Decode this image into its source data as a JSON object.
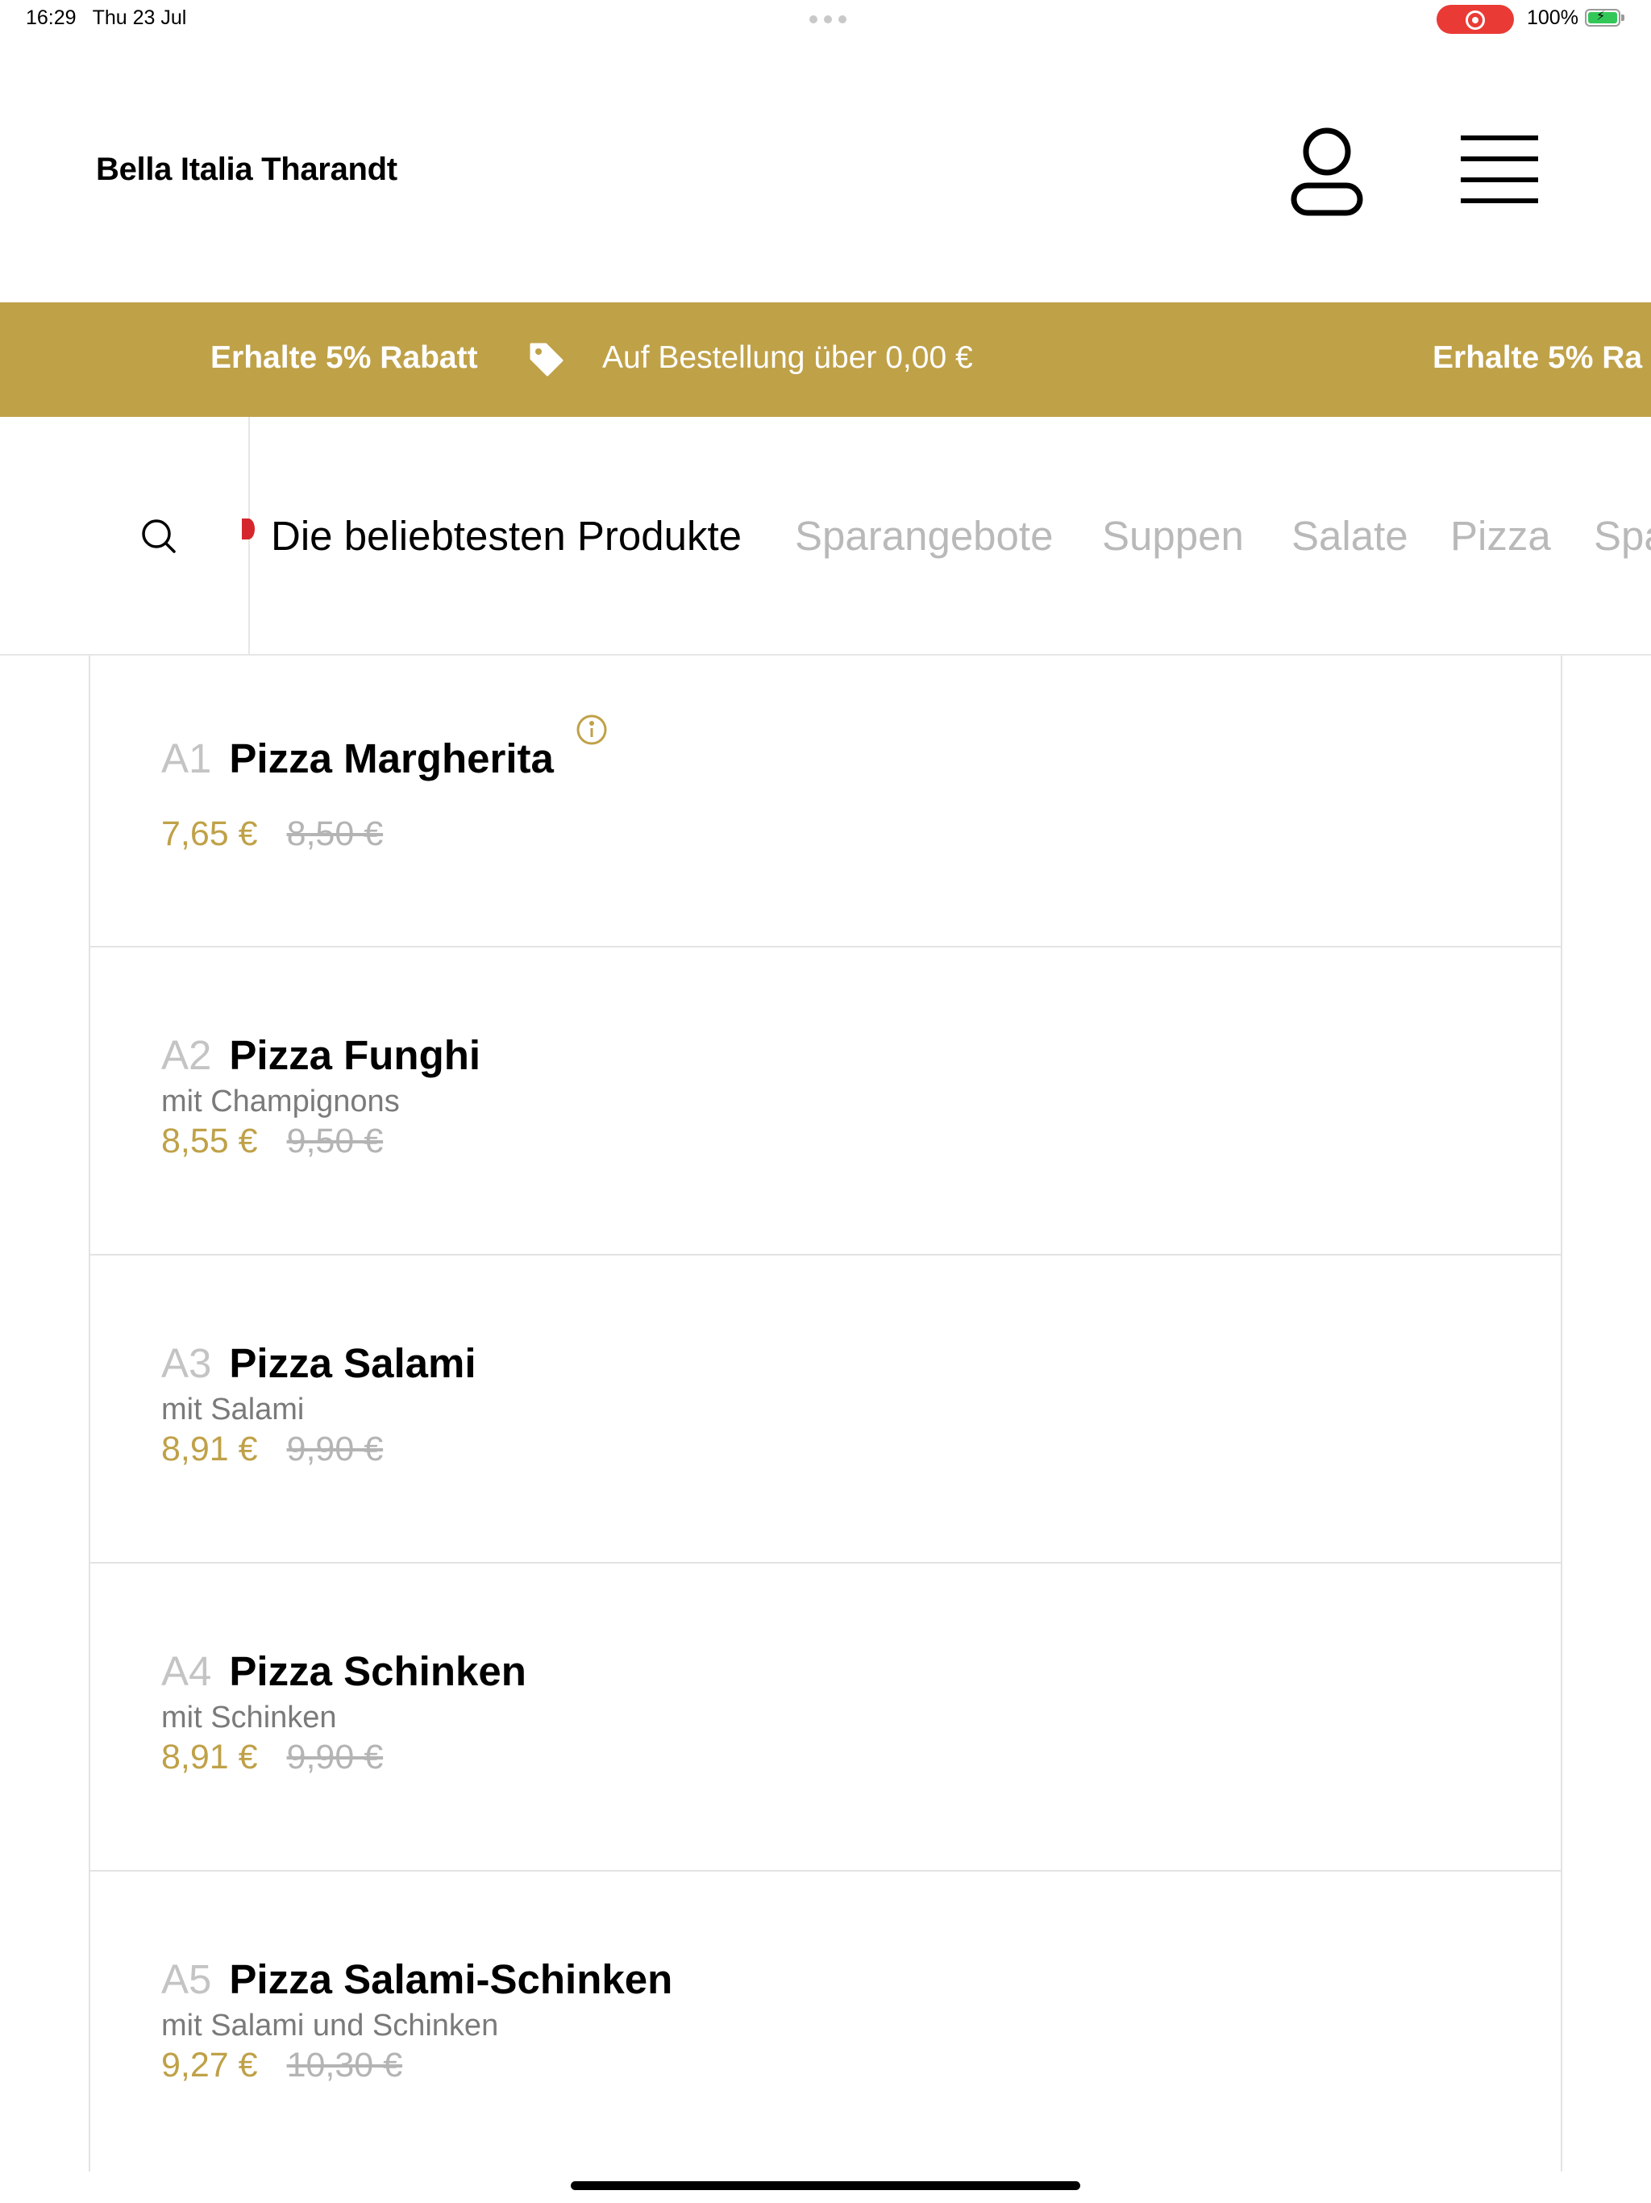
{
  "status_bar": {
    "time": "16:29",
    "date": "Thu 23 Jul",
    "battery_percent": "100%"
  },
  "header": {
    "brand": "Bella Italia Tharandt",
    "user_icon": "user-icon",
    "menu_icon": "hamburger-menu-icon"
  },
  "promo": {
    "headline": "Erhalte 5% Rabatt",
    "condition": "Auf Bestellung über 0,00 €",
    "repeat_headline": "Erhalte 5% Ra",
    "icon": "tag-icon",
    "background_color": "#bfa148"
  },
  "categories": {
    "search_icon": "search-icon",
    "items": [
      {
        "label": "Die beliebtesten Produkte",
        "active": true
      },
      {
        "label": "Sparangebote",
        "active": false
      },
      {
        "label": "Suppen",
        "active": false
      },
      {
        "label": "Salate",
        "active": false
      },
      {
        "label": "Pizza",
        "active": false
      },
      {
        "label": "Spa",
        "active": false
      }
    ]
  },
  "products": [
    {
      "code": "A1",
      "name": "Pizza Margherita",
      "description": "",
      "price": "7,65 €",
      "old_price": "8,50 €",
      "has_info": true
    },
    {
      "code": "A2",
      "name": "Pizza Funghi",
      "description": "mit Champignons",
      "price": "8,55 €",
      "old_price": "9,50 €",
      "has_info": false
    },
    {
      "code": "A3",
      "name": "Pizza Salami",
      "description": "mit Salami",
      "price": "8,91 €",
      "old_price": "9,90 €",
      "has_info": false
    },
    {
      "code": "A4",
      "name": "Pizza Schinken",
      "description": "mit Schinken",
      "price": "8,91 €",
      "old_price": "9,90 €",
      "has_info": false
    },
    {
      "code": "A5",
      "name": "Pizza Salami-Schinken",
      "description": "mit Salami und Schinken",
      "price": "9,27 €",
      "old_price": "10,30 €",
      "has_info": false
    }
  ],
  "colors": {
    "accent": "#bfa148",
    "category_active": "#000000",
    "category_inactive": "#b9b9b9",
    "record_indicator": "#ea3a35"
  }
}
